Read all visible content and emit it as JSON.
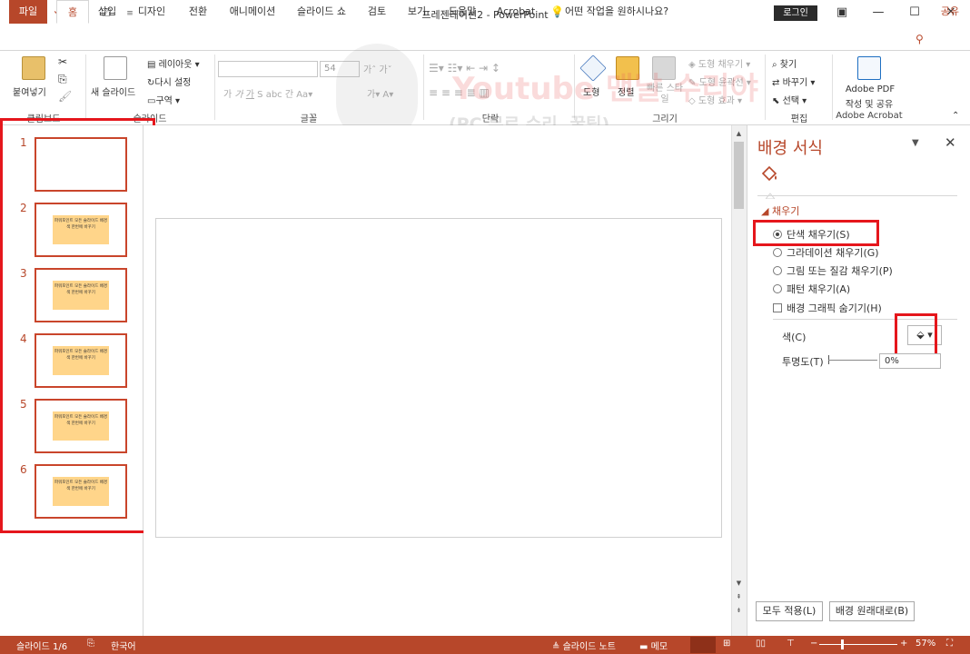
{
  "window": {
    "title": "프레젠테이션2 - PowerPoint",
    "login": "로그인"
  },
  "tabs": {
    "file": "파일",
    "items": [
      "홈",
      "삽입",
      "디자인",
      "전환",
      "애니메이션",
      "슬라이드 쇼",
      "검토",
      "보기",
      "도움말",
      "Acrobat"
    ],
    "tell_me": "어떤 작업을 원하시나요?",
    "share": "공유"
  },
  "ribbon": {
    "clipboard": {
      "paste": "붙여넣기",
      "label": "클립보드"
    },
    "slides": {
      "new_slide": "새 슬라이드",
      "layout": "레이아웃",
      "reset": "다시 설정",
      "section": "구역",
      "label": "슬라이드"
    },
    "font": {
      "size": "54",
      "label": "글꼴"
    },
    "paragraph": {
      "label": "단락"
    },
    "drawing": {
      "shapes": "도형",
      "arrange": "정렬",
      "quick_styles": "빠른 스타일",
      "fill": "도형 채우기",
      "outline": "도형 윤곽선",
      "effects": "도형 효과",
      "label": "그리기"
    },
    "editing": {
      "find": "찾기",
      "replace": "바꾸기",
      "select": "선택",
      "label": "편집"
    },
    "acrobat": {
      "create_pdf_1": "Adobe PDF",
      "create_pdf_2": "작성 및 공유",
      "label": "Adobe Acrobat"
    }
  },
  "watermark": {
    "title": "Youtube 맨날 수리야",
    "subtitle": "(PC 무료 수리, 꿀팁)"
  },
  "thumbnails": {
    "note": "파워포인트 모든 슬라이드 배경색 한번에 바꾸기",
    "numbers": [
      "1",
      "2",
      "3",
      "4",
      "5",
      "6"
    ]
  },
  "format_pane": {
    "title": "배경 서식",
    "section": "채우기",
    "options": [
      "단색 채우기(S)",
      "그라데이션 채우기(G)",
      "그림 또는 질감 채우기(P)",
      "패턴 채우기(A)"
    ],
    "hide_graphics": "배경 그래픽 숨기기(H)",
    "color_label": "색(C)",
    "transparency_label": "투명도(T)",
    "transparency_value": "0%",
    "apply_all": "모두 적용(L)",
    "reset_bg": "배경 원래대로(B)"
  },
  "status": {
    "slide": "슬라이드 1/6",
    "language": "한국어",
    "notes": "슬라이드 노트",
    "comments": "메모",
    "zoom": "57%"
  },
  "colors": {
    "accent": "#b7472a",
    "highlight": "#e5161c",
    "thumb_fill": "#ffd58a"
  }
}
